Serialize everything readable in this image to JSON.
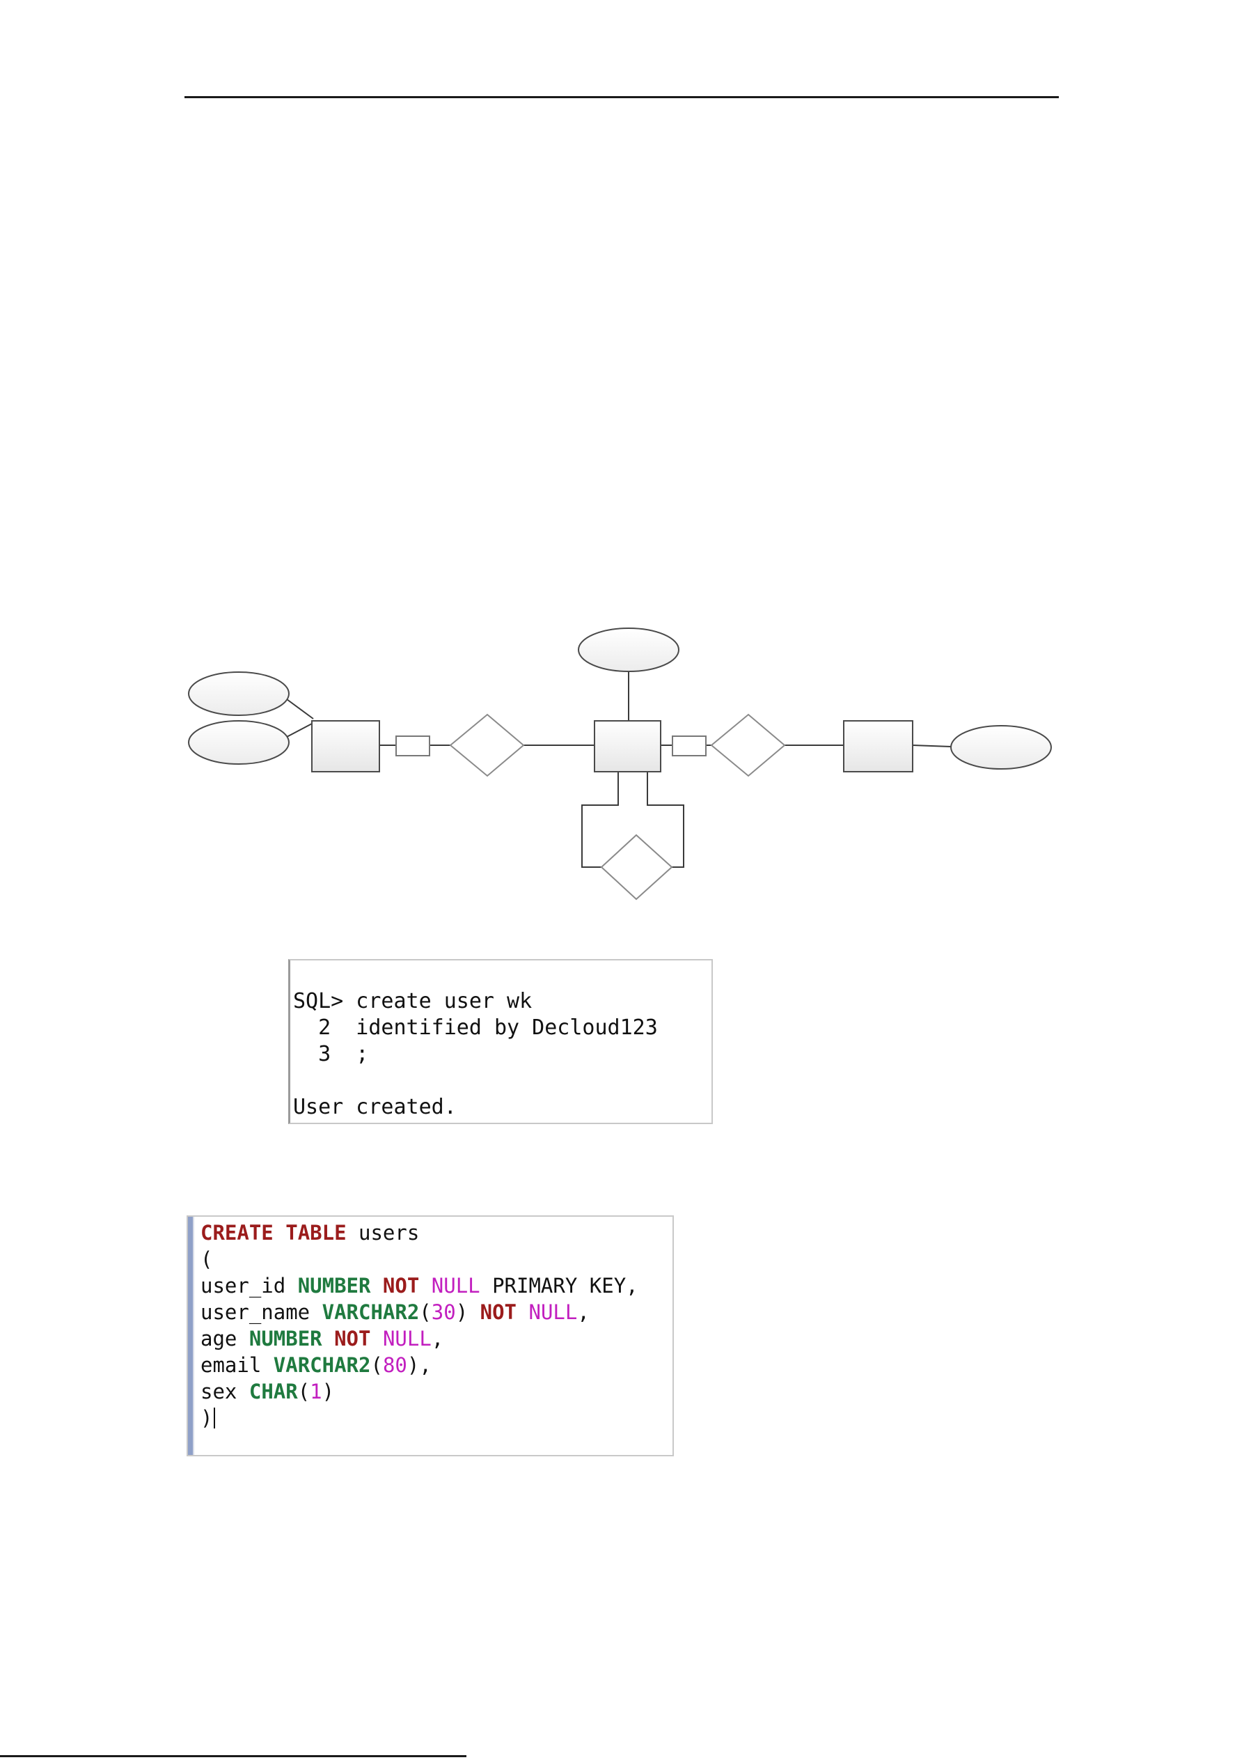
{
  "console": {
    "lines": [
      "",
      "SQL> create user wk",
      "  2  identified by Decloud123",
      "  3  ;",
      "",
      "User created."
    ]
  },
  "editor": {
    "line1": {
      "kw1": "CREATE",
      "kw2": "TABLE",
      "name": "users"
    },
    "line2": "(",
    "line3": {
      "col": "user_id",
      "type": "NUMBER",
      "not": "NOT",
      "null": "NULL",
      "rest": "PRIMARY KEY,"
    },
    "line4": {
      "col": "user_name",
      "type": "VARCHAR2",
      "open": "(",
      "num": "30",
      "close": ")",
      "not": "NOT",
      "null": "NULL",
      "comma": ","
    },
    "line5": {
      "col": "age",
      "type": "NUMBER",
      "not": "NOT",
      "null": "NULL",
      "comma": ","
    },
    "line6": {
      "col": "email",
      "type": "VARCHAR2",
      "open": "(",
      "num": "80",
      "close": "),"
    },
    "line7": {
      "col": "sex",
      "type": "CHAR",
      "open": "(",
      "num": "1",
      "close": ")"
    },
    "line8": ")"
  },
  "colors": {
    "keyword": "#9b1c1c",
    "type": "#1f7a3f",
    "literal": "#c21fbf"
  }
}
